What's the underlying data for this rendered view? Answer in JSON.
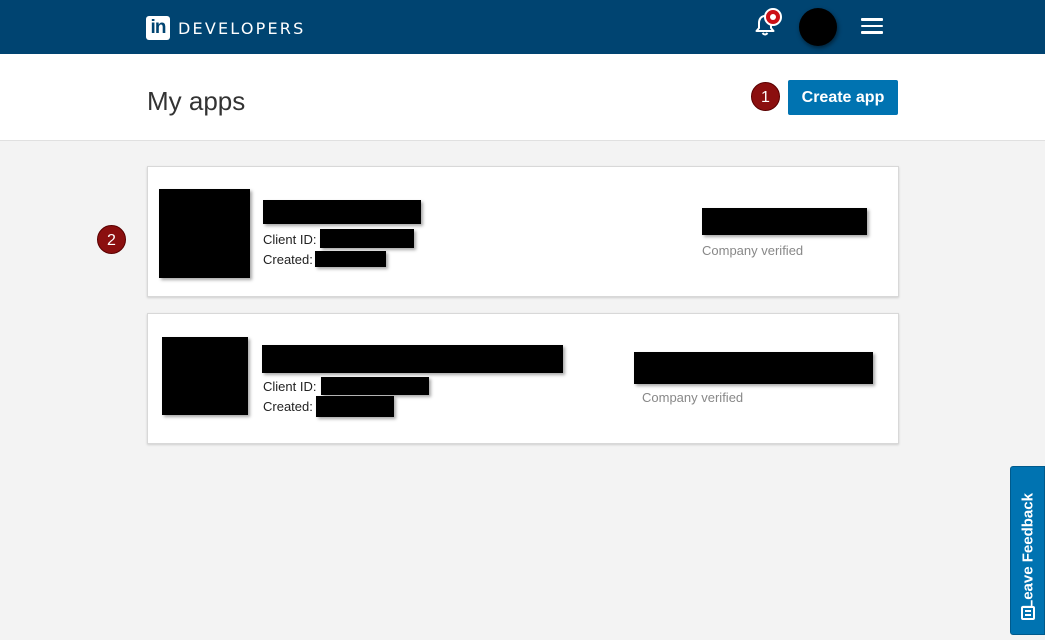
{
  "topbar": {
    "logo_text": "in",
    "brand": "DEVELOPERS"
  },
  "header": {
    "title": "My apps",
    "create_label": "Create app"
  },
  "steps": [
    "1",
    "2"
  ],
  "apps": [
    {
      "client_id_label": "Client ID:",
      "created_label": "Created:",
      "status": "Company verified"
    },
    {
      "client_id_label": "Client ID:",
      "created_label": "Created:",
      "status": "Company verified"
    }
  ],
  "feedback": {
    "label": "Leave Feedback"
  },
  "colors": {
    "topbar": "#004471",
    "accent": "#0073b1",
    "step_badge": "#8b0f0f"
  }
}
